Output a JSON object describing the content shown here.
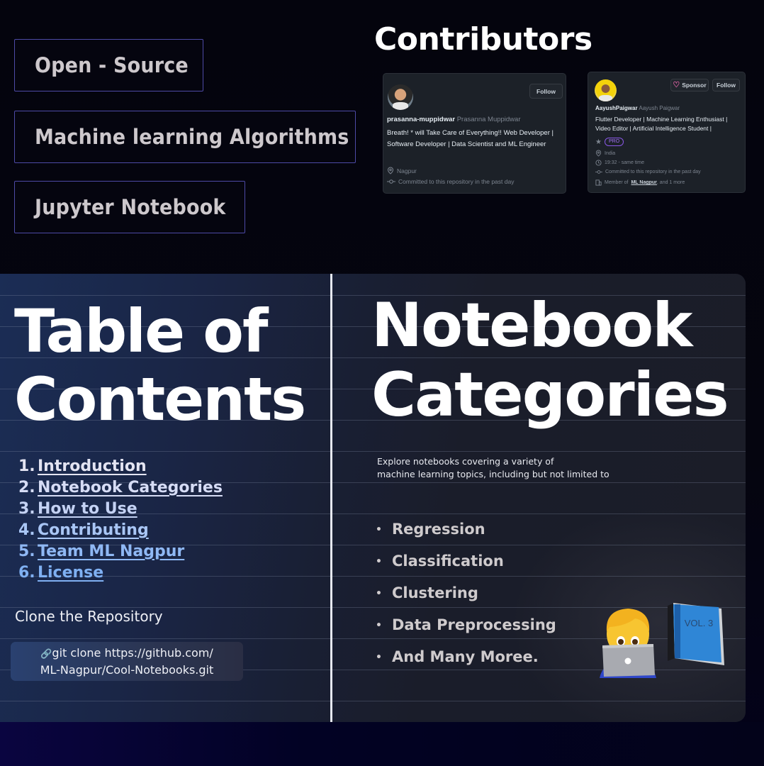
{
  "tags": [
    "Open - Source",
    "Machine learning Algorithms",
    "Jupyter Notebook"
  ],
  "contributors": {
    "title": "Contributors",
    "cards": [
      {
        "username": "prasanna-muppidwar",
        "full_name": "Prasanna Muppidwar",
        "bio": "Breath! * will Take Care of Everything!! Web Developer | Software Developer | Data Scientist and ML Engineer",
        "location": "Nagpur",
        "activity": "Committed to this repository in the past day",
        "follow_label": "Follow",
        "avatar_icon": "user-avatar"
      },
      {
        "username": "AayushPaigwar",
        "full_name": "Aayush Paigwar",
        "bio": "Flutter Developer | Machine Learning Enthusiast | Video Editor | Artificial Intelligence Student |",
        "badge": "PRO",
        "location": "India",
        "local_time": "19:32 - same time",
        "activity": "Committed to this repository in the past day",
        "member_prefix": "Member of",
        "member_org": "ML Nagpur",
        "member_suffix": ", and 1 more",
        "sponsor_label": "Sponsor",
        "follow_label": "Follow",
        "avatar_icon": "user-avatar"
      }
    ]
  },
  "toc": {
    "title_line1": "Table of",
    "title_line2": "Contents",
    "items": [
      {
        "num": "1.",
        "label": "Introduction",
        "color": "#e3e4f2"
      },
      {
        "num": "2.",
        "label": "Notebook Categories",
        "color": "#d6dcf5"
      },
      {
        "num": "3.",
        "label": "How to Use",
        "color": "#c4d2f4"
      },
      {
        "num": "4.",
        "label": "Contributing",
        "color": "#a9c6f5"
      },
      {
        "num": "5.",
        "label": "Team ML Nagpur",
        "color": "#8fb8f4"
      },
      {
        "num": "6.",
        "label": "License",
        "color": "#7fb0f2"
      }
    ],
    "clone_label": "Clone the Repository",
    "clone_icon": "🔗",
    "clone_line1": "git clone https://github.com/",
    "clone_line2": "ML-Nagpur/Cool-Notebooks.git"
  },
  "categories": {
    "title_line1": "Notebook",
    "title_line2": "Categories",
    "desc_line1": "Explore notebooks covering a variety of",
    "desc_line2": "machine learning topics, including but not limited to",
    "items": [
      "Regression",
      "Classification",
      "Clustering",
      "Data Preprocessing",
      "And Many Moree."
    ],
    "bullet": "•",
    "emoji_technologist": "🧑‍💻",
    "emoji_book": "📘"
  }
}
